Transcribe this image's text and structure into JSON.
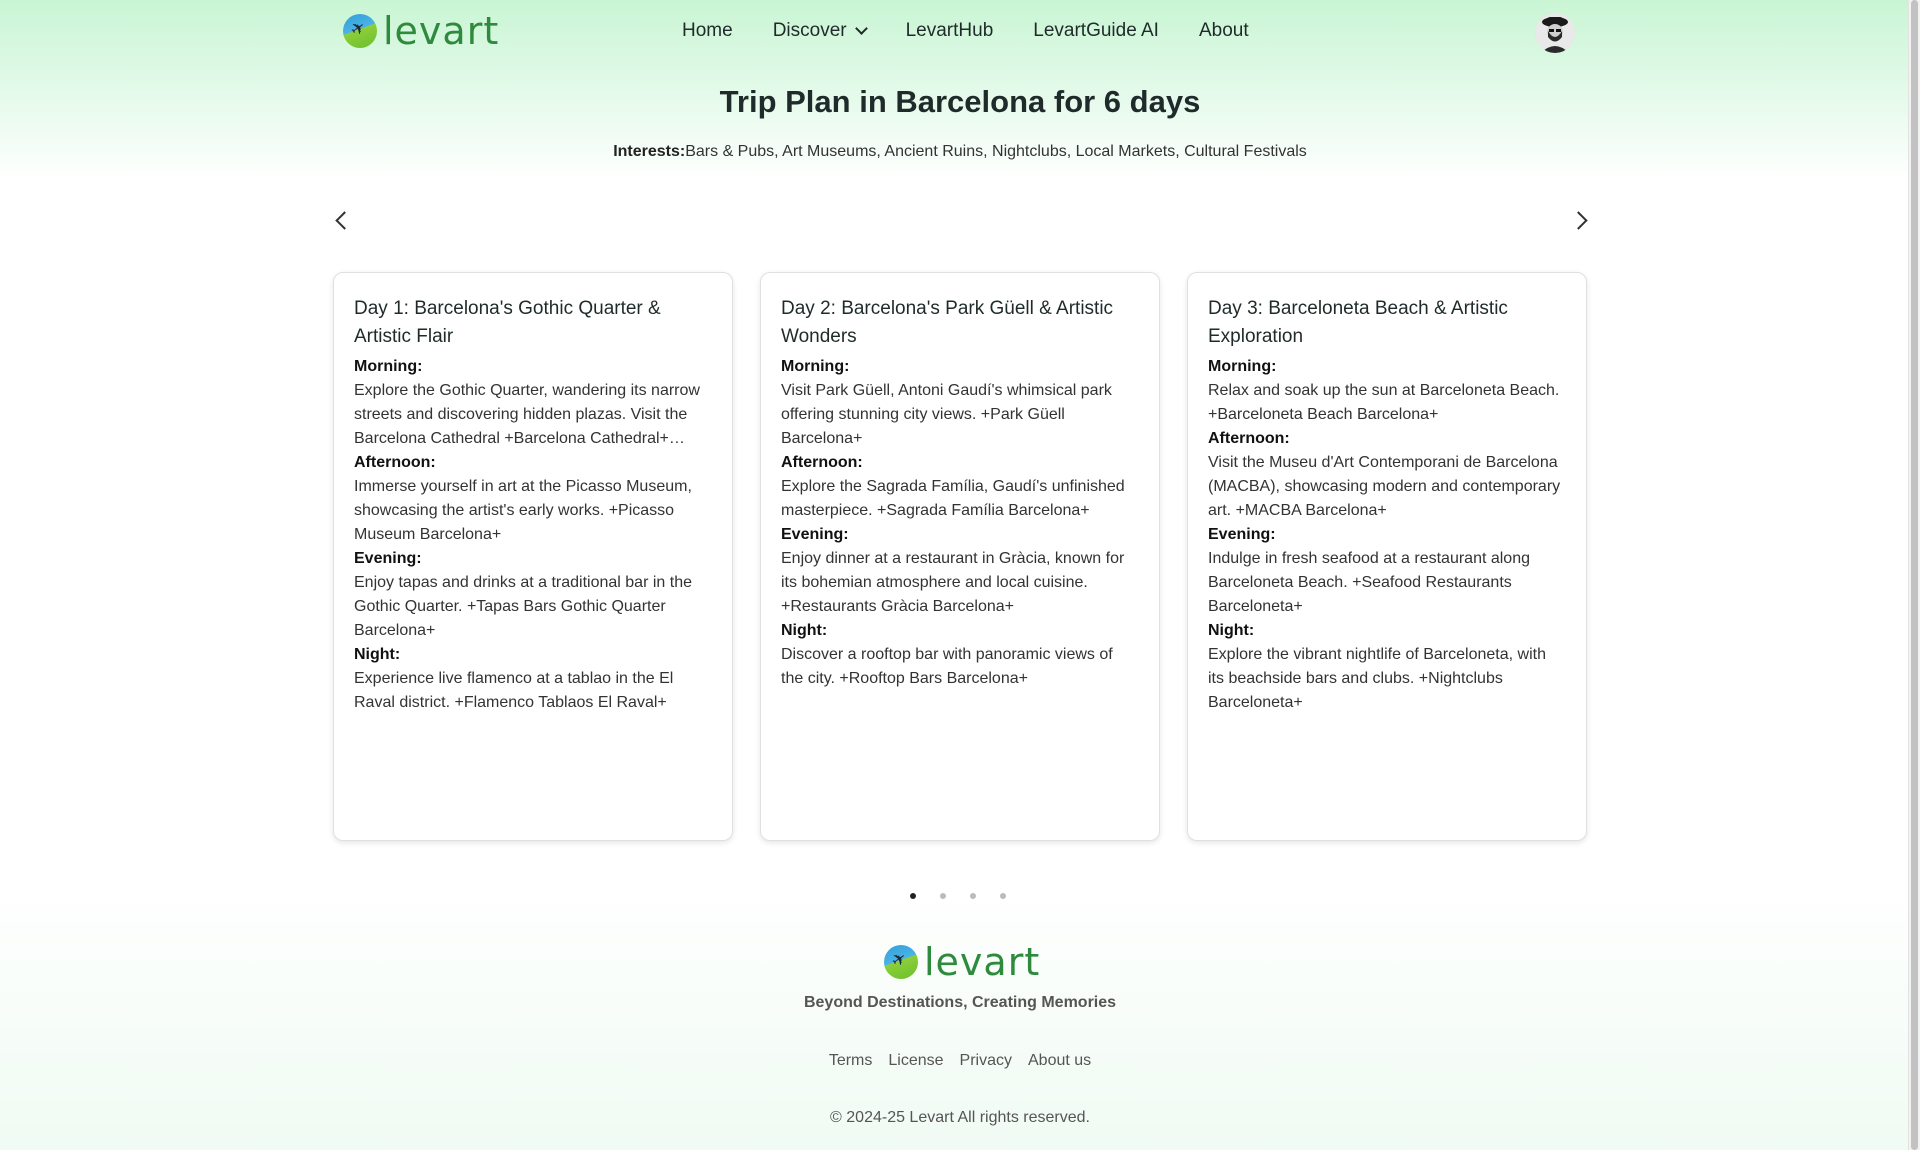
{
  "brand": {
    "name": "levart"
  },
  "nav": {
    "items": [
      {
        "label": "Home"
      },
      {
        "label": "Discover"
      },
      {
        "label": "LevartHub"
      },
      {
        "label": "LevartGuide AI"
      },
      {
        "label": "About"
      }
    ]
  },
  "page": {
    "title": "Trip Plan in Barcelona for 6 days",
    "interests_label": "Interests:",
    "interests_value": "Bars & Pubs, Art Museums, Ancient Ruins, Nightclubs, Local Markets, Cultural Festivals"
  },
  "carousel": {
    "active_dot": 1,
    "dot_count": 4,
    "cards": [
      {
        "title": "Day 1: Barcelona's Gothic Quarter & Artistic Flair",
        "morning_label": "Morning:",
        "morning": "Explore the Gothic Quarter, wandering its narrow streets and discovering hidden plazas. Visit the Barcelona Cathedral +Barcelona Cathedral+ and...",
        "afternoon_label": "Afternoon:",
        "afternoon": "Immerse yourself in art at the Picasso Museum, showcasing the artist's early works. +Picasso Museum Barcelona+",
        "evening_label": "Evening:",
        "evening": "Enjoy tapas and drinks at a traditional bar in the Gothic Quarter. +Tapas Bars Gothic Quarter Barcelona+",
        "night_label": "Night:",
        "night": "Experience live flamenco at a tablao in the El Raval district. +Flamenco Tablaos El Raval+"
      },
      {
        "title": "Day 2: Barcelona's Park Güell & Artistic Wonders",
        "morning_label": "Morning:",
        "morning": "Visit Park Güell, Antoni Gaudí's whimsical park offering stunning city views. +Park Güell Barcelona+",
        "afternoon_label": "Afternoon:",
        "afternoon": "Explore the Sagrada Família, Gaudí's unfinished masterpiece. +Sagrada Família Barcelona+",
        "evening_label": "Evening:",
        "evening": "Enjoy dinner at a restaurant in Gràcia, known for its bohemian atmosphere and local cuisine. +Restaurants Gràcia Barcelona+",
        "night_label": "Night:",
        "night": "Discover a rooftop bar with panoramic views of the city. +Rooftop Bars Barcelona+"
      },
      {
        "title": "Day 3: Barceloneta Beach & Artistic Exploration",
        "morning_label": "Morning:",
        "morning": "Relax and soak up the sun at Barceloneta Beach. +Barceloneta Beach Barcelona+",
        "afternoon_label": "Afternoon:",
        "afternoon": "Visit the Museu d'Art Contemporani de Barcelona (MACBA), showcasing modern and contemporary art. +MACBA Barcelona+",
        "evening_label": "Evening:",
        "evening": "Indulge in fresh seafood at a restaurant along Barceloneta Beach. +Seafood Restaurants Barceloneta+",
        "night_label": "Night:",
        "night": "Explore the vibrant nightlife of Barceloneta, with its beachside bars and clubs. +Nightclubs Barceloneta+"
      }
    ]
  },
  "footer": {
    "brand": "levart",
    "tagline": "Beyond Destinations, Creating Memories",
    "links": [
      "Terms",
      "License",
      "Privacy",
      "About us"
    ],
    "copyright": "© 2024-25 Levart All rights reserved."
  },
  "colors": {
    "brand_green": "#2e8b3e",
    "header_mint": "#c9f5d4"
  },
  "icons": {
    "logo": "globe-plane-icon",
    "prev": "chevron-left-icon",
    "next": "chevron-right-icon",
    "dropdown": "chevron-down-icon"
  }
}
